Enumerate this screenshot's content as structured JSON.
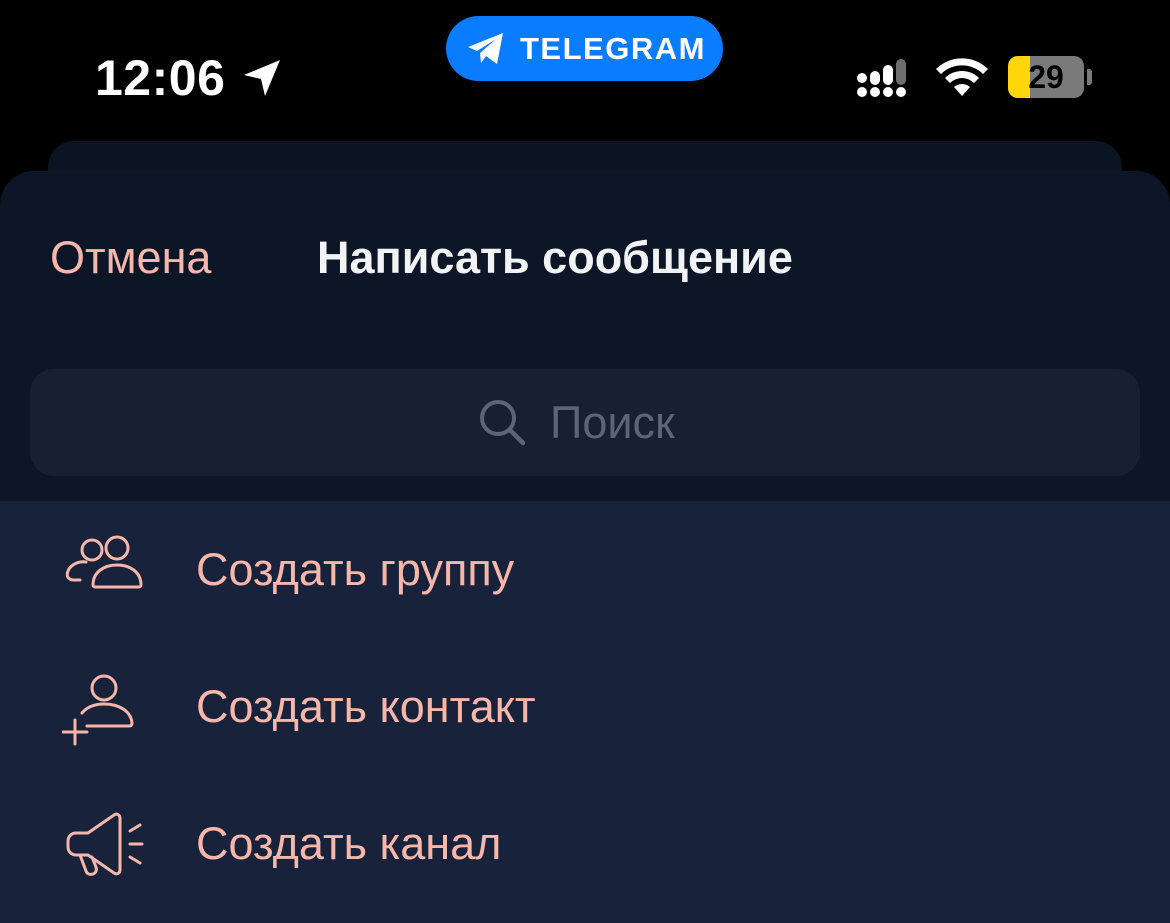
{
  "status_bar": {
    "time": "12:06",
    "app_pill_label": "TELEGRAM",
    "battery_level": "29",
    "battery_fraction": 0.29,
    "battery_color": "#ffd60a",
    "pill_color": "#0a7cff"
  },
  "header": {
    "cancel_label": "Отмена",
    "title": "Написать сообщение"
  },
  "search": {
    "placeholder": "Поиск",
    "value": ""
  },
  "menu": {
    "items": [
      {
        "icon": "group-icon",
        "label": "Создать группу"
      },
      {
        "icon": "add-contact-icon",
        "label": "Создать контакт"
      },
      {
        "icon": "megaphone-icon",
        "label": "Создать канал"
      }
    ]
  },
  "colors": {
    "accent": "#f6b6aa",
    "background": "#0c1626",
    "menu_background": "#18223a",
    "search_background": "#172033",
    "title_text": "#f2f3f5",
    "placeholder_text": "#5b6577"
  }
}
